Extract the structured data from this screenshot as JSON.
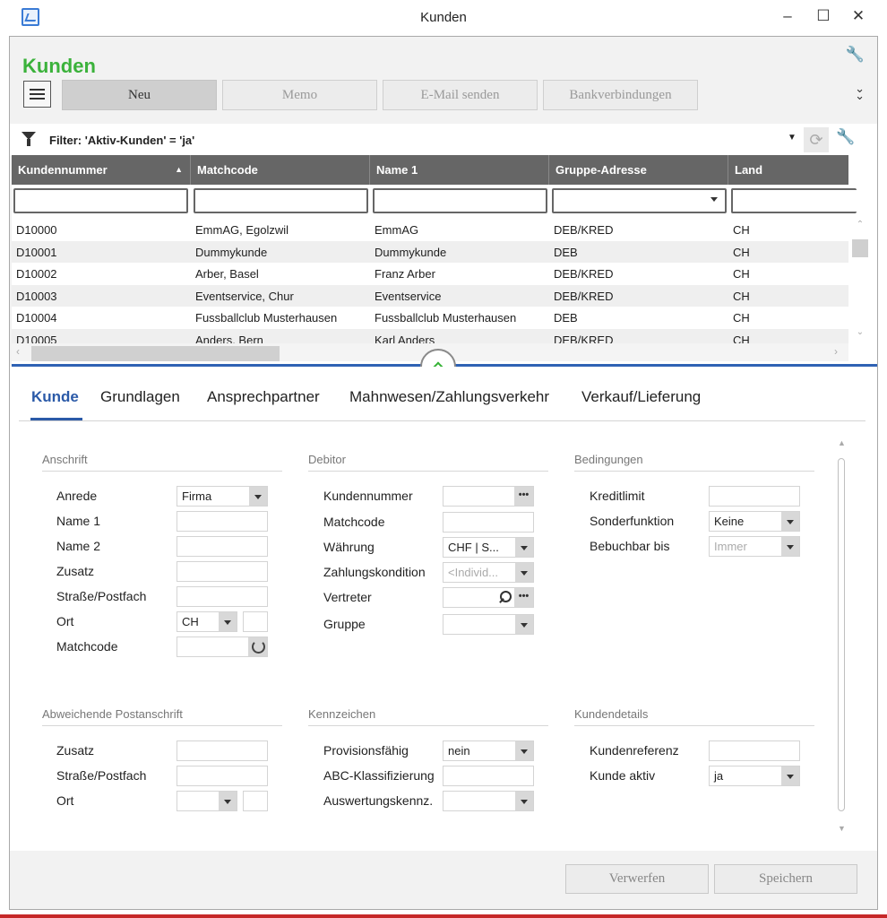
{
  "window": {
    "title": "Kunden",
    "minimize": "–",
    "maximize": "☐",
    "close": "✕"
  },
  "page": {
    "title": "Kunden",
    "title_color": "#3bb23b"
  },
  "toolbar": {
    "new_label": "Neu",
    "memo_label": "Memo",
    "email_label": "E-Mail senden",
    "bank_label": "Bankverbindungen"
  },
  "filter": {
    "text": "Filter: 'Aktiv-Kunden' = 'ja'"
  },
  "grid": {
    "columns": [
      "Kundennummer",
      "Matchcode",
      "Name 1",
      "Gruppe-Adresse",
      "Land"
    ],
    "rows": [
      [
        "D10000",
        "EmmAG, Egolzwil",
        "EmmAG",
        "DEB/KRED",
        "CH"
      ],
      [
        "D10001",
        "Dummykunde",
        "Dummykunde",
        "DEB",
        "CH"
      ],
      [
        "D10002",
        "Arber, Basel",
        "Franz Arber",
        "DEB/KRED",
        "CH"
      ],
      [
        "D10003",
        "Eventservice, Chur",
        "Eventservice",
        "DEB/KRED",
        "CH"
      ],
      [
        "D10004",
        "Fussballclub Musterhausen",
        "Fussballclub Musterhausen",
        "DEB",
        "CH"
      ],
      [
        "D10005",
        "Anders, Bern",
        "Karl Anders",
        "DEB/KRED",
        "CH"
      ]
    ]
  },
  "tabs": [
    "Kunde",
    "Grundlagen",
    "Ansprechpartner",
    "Mahnwesen/Zahlungsverkehr",
    "Verkauf/Lieferung"
  ],
  "anschrift": {
    "title": "Anschrift",
    "anrede_label": "Anrede",
    "anrede_value": "Firma",
    "name1_label": "Name 1",
    "name2_label": "Name 2",
    "zusatz_label": "Zusatz",
    "strasse_label": "Straße/Postfach",
    "ort_label": "Ort",
    "ort_country": "CH",
    "matchcode_label": "Matchcode"
  },
  "debitor": {
    "title": "Debitor",
    "kundennummer_label": "Kundennummer",
    "matchcode_label": "Matchcode",
    "waehrung_label": "Währung",
    "waehrung_value": "CHF  |  S...",
    "zahlungskondition_label": "Zahlungskondition",
    "zahlungskondition_value": "<Individ...",
    "vertreter_label": "Vertreter",
    "gruppe_label": "Gruppe",
    "dots": "•••"
  },
  "bedingungen": {
    "title": "Bedingungen",
    "kreditlimit_label": "Kreditlimit",
    "sonderfunktion_label": "Sonderfunktion",
    "sonderfunktion_value": "Keine",
    "bebuchbar_label": "Bebuchbar bis",
    "bebuchbar_value": "Immer"
  },
  "postanschrift": {
    "title": "Abweichende Postanschrift",
    "zusatz_label": "Zusatz",
    "strasse_label": "Straße/Postfach",
    "ort_label": "Ort"
  },
  "kennzeichen": {
    "title": "Kennzeichen",
    "provision_label": "Provisionsfähig",
    "provision_value": "nein",
    "abc_label": "ABC-Klassifizierung",
    "auswertung_label": "Auswertungskennz."
  },
  "kundendetails": {
    "title": "Kundendetails",
    "referenz_label": "Kundenreferenz",
    "aktiv_label": "Kunde aktiv",
    "aktiv_value": "ja"
  },
  "footer": {
    "discard_label": "Verwerfen",
    "save_label": "Speichern"
  },
  "colors": {
    "accent_green": "#3bb23b",
    "tab_blue": "#2b5aa8",
    "header_gray": "#666666",
    "splitter_blue": "#2f62b4"
  },
  "icons": [
    "app-icon",
    "menu-icon",
    "wrench-icon",
    "double-chevron-down-icon",
    "filter-icon",
    "refresh-icon",
    "search-icon",
    "collapse-up-icon"
  ]
}
